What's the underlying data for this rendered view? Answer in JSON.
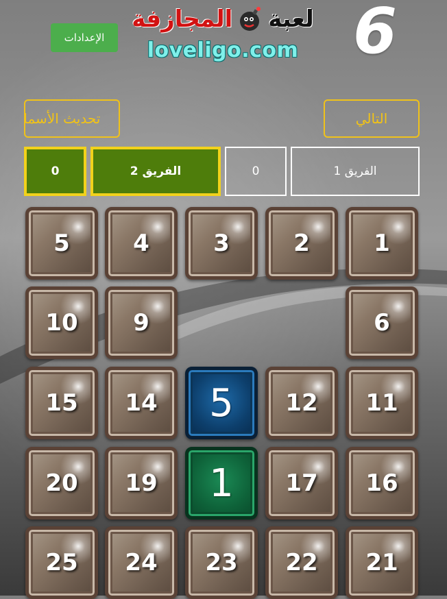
{
  "header": {
    "round_number": "6",
    "settings_label": "الإعدادات",
    "logo_word1": "لعبة",
    "logo_word2": "المجازفة",
    "logo_url": "loveligo.com"
  },
  "controls": {
    "next_label": "التالي",
    "refresh_names_label": "تحديث الأسماء"
  },
  "scoreboard": {
    "team1_name": "الفريق 1",
    "team1_score": "0",
    "team2_name": "الفريق 2",
    "team2_score": "0",
    "active_team_color": "#4e7d0b",
    "active_border_color": "#f2d21b"
  },
  "board": {
    "tiles": [
      {
        "label": "1",
        "state": "hidden"
      },
      {
        "label": "2",
        "state": "hidden"
      },
      {
        "label": "3",
        "state": "hidden"
      },
      {
        "label": "4",
        "state": "hidden"
      },
      {
        "label": "5",
        "state": "hidden"
      },
      {
        "label": "6",
        "state": "hidden"
      },
      {
        "label": "",
        "state": "removed"
      },
      {
        "label": "",
        "state": "removed"
      },
      {
        "label": "9",
        "state": "hidden"
      },
      {
        "label": "10",
        "state": "hidden"
      },
      {
        "label": "11",
        "state": "hidden"
      },
      {
        "label": "12",
        "state": "hidden"
      },
      {
        "label": "5",
        "state": "revealed-blue"
      },
      {
        "label": "14",
        "state": "hidden"
      },
      {
        "label": "15",
        "state": "hidden"
      },
      {
        "label": "16",
        "state": "hidden"
      },
      {
        "label": "17",
        "state": "hidden"
      },
      {
        "label": "1",
        "state": "revealed-green"
      },
      {
        "label": "19",
        "state": "hidden"
      },
      {
        "label": "20",
        "state": "hidden"
      },
      {
        "label": "21",
        "state": "hidden"
      },
      {
        "label": "22",
        "state": "hidden"
      },
      {
        "label": "23",
        "state": "hidden"
      },
      {
        "label": "24",
        "state": "hidden"
      },
      {
        "label": "25",
        "state": "hidden"
      }
    ]
  }
}
